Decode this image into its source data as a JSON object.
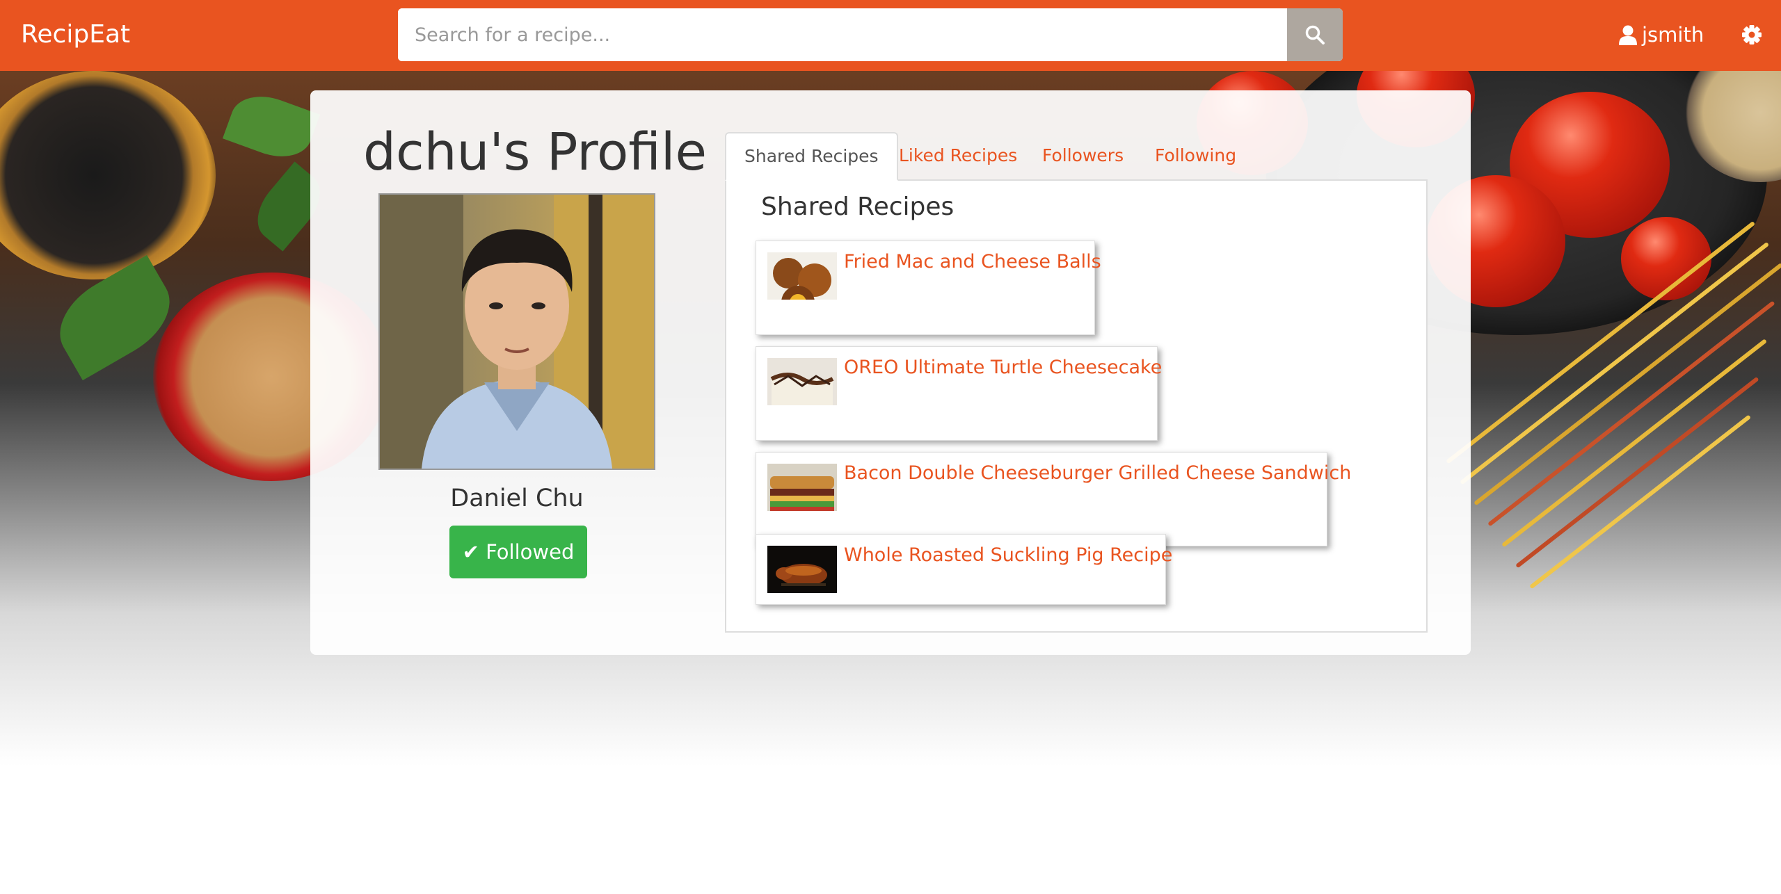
{
  "navbar": {
    "brand": "RecipEat",
    "search_placeholder": "Search for a recipe...",
    "username": "jsmith",
    "icons": {
      "search": "search-icon",
      "user": "user-icon",
      "settings": "gear-icon"
    },
    "color": "#e95420"
  },
  "profile": {
    "title": "dchu's Profile",
    "full_name": "Daniel Chu",
    "follow_button": "✔ Followed"
  },
  "tabs": [
    {
      "label": "Shared Recipes",
      "active": true
    },
    {
      "label": "Liked Recipes",
      "active": false
    },
    {
      "label": "Followers",
      "active": false
    },
    {
      "label": "Following",
      "active": false
    }
  ],
  "panel": {
    "title": "Shared Recipes",
    "recipes": [
      {
        "name": "Fried Mac and Cheese Balls"
      },
      {
        "name": "OREO Ultimate Turtle Cheesecake"
      },
      {
        "name": "Bacon Double Cheeseburger Grilled Cheese Sandwich"
      },
      {
        "name": "Whole Roasted Suckling Pig Recipe"
      }
    ]
  },
  "colors": {
    "accent": "#e95420",
    "success": "#38b44a",
    "search_button": "#aea79f"
  }
}
